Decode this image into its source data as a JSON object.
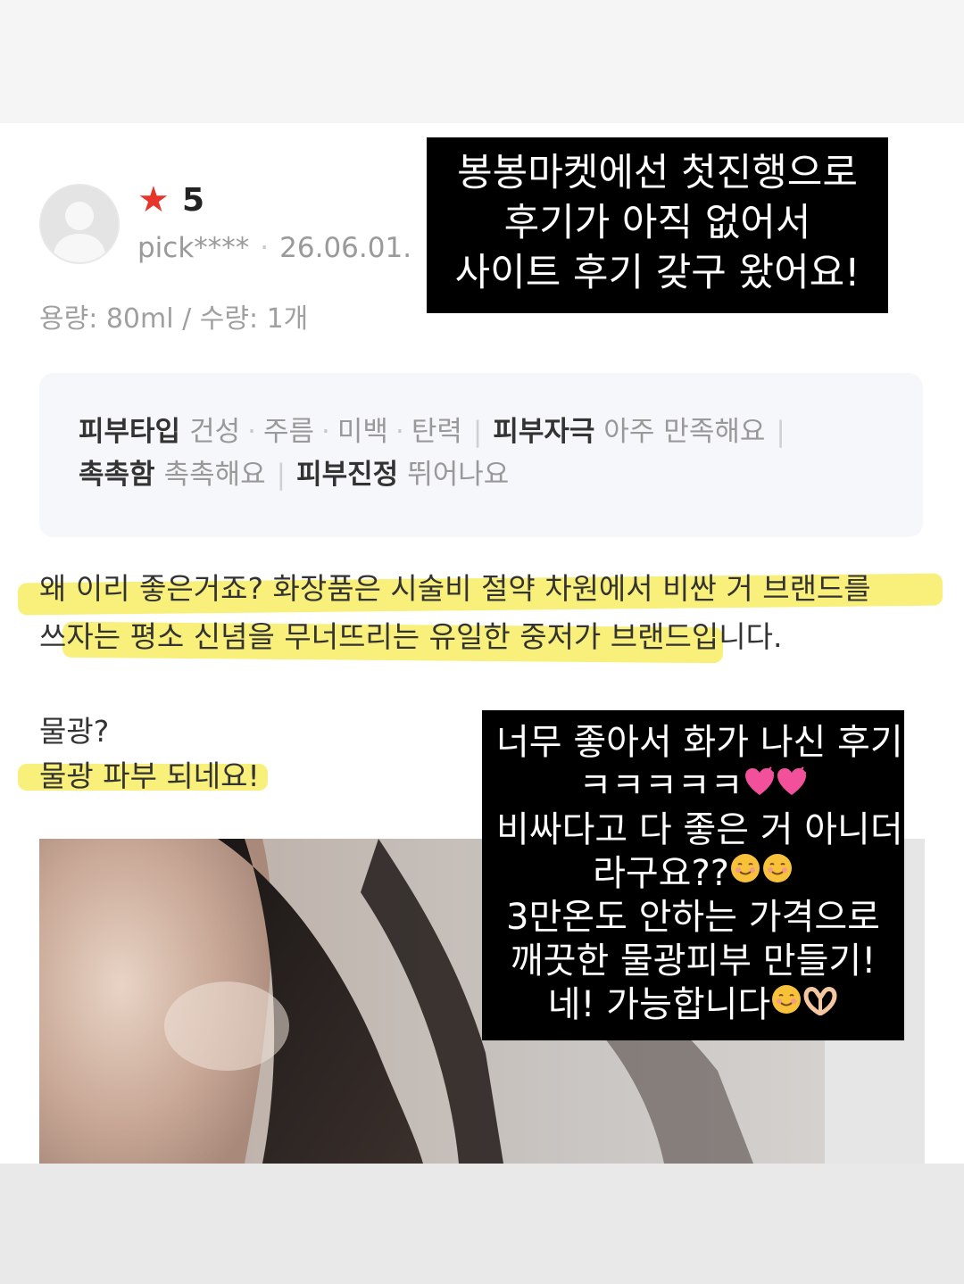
{
  "review": {
    "rating_icon": "star-icon",
    "rating": "5",
    "user": "pick****",
    "date": "26.06.01.",
    "option": "용량: 80ml / 수량: 1개",
    "summary": {
      "skin_type_label": "피부타입",
      "skin_type_values": [
        "건성",
        "주름",
        "미백",
        "탄력"
      ],
      "irritation_label": "피부자극",
      "irritation_value": "아주 만족해요",
      "moisture_label": "촉촉함",
      "moisture_value": "촉촉해요",
      "soothing_label": "피부진정",
      "soothing_value": "뛰어나요"
    },
    "text_line1": "왜 이리 좋은거죠? 화장품은 시술비 절약 차원에서 비싼 거 브랜드를",
    "text_line2": "쓰자는 평소 신념을 무너뜨리는 유일한 중저가 브랜드입니다.",
    "text_line3": "물광?",
    "text_line4": "물광 파부 되네요!"
  },
  "overlay_note_1": {
    "line1": "봉봉마켓에선 첫진행으로",
    "line2": "후기가 아직 없어서",
    "line3": "사이트 후기 갖구 왔어요!"
  },
  "overlay_note_2": {
    "line1": "너무 좋아서 화가 나신 후기",
    "line2": "ㅋㅋㅋㅋㅋ",
    "line3": "비싸다고 다 좋은 거 아니더",
    "line4": "라구요??",
    "line5": "3만온도 안하는 가격으로",
    "line6": "깨끗한 물광피부 만들기!",
    "line7": "네! 가능합니다"
  },
  "colors": {
    "star": "#e8352b",
    "highlight": "#f8f07a",
    "note_bg": "#000000"
  }
}
